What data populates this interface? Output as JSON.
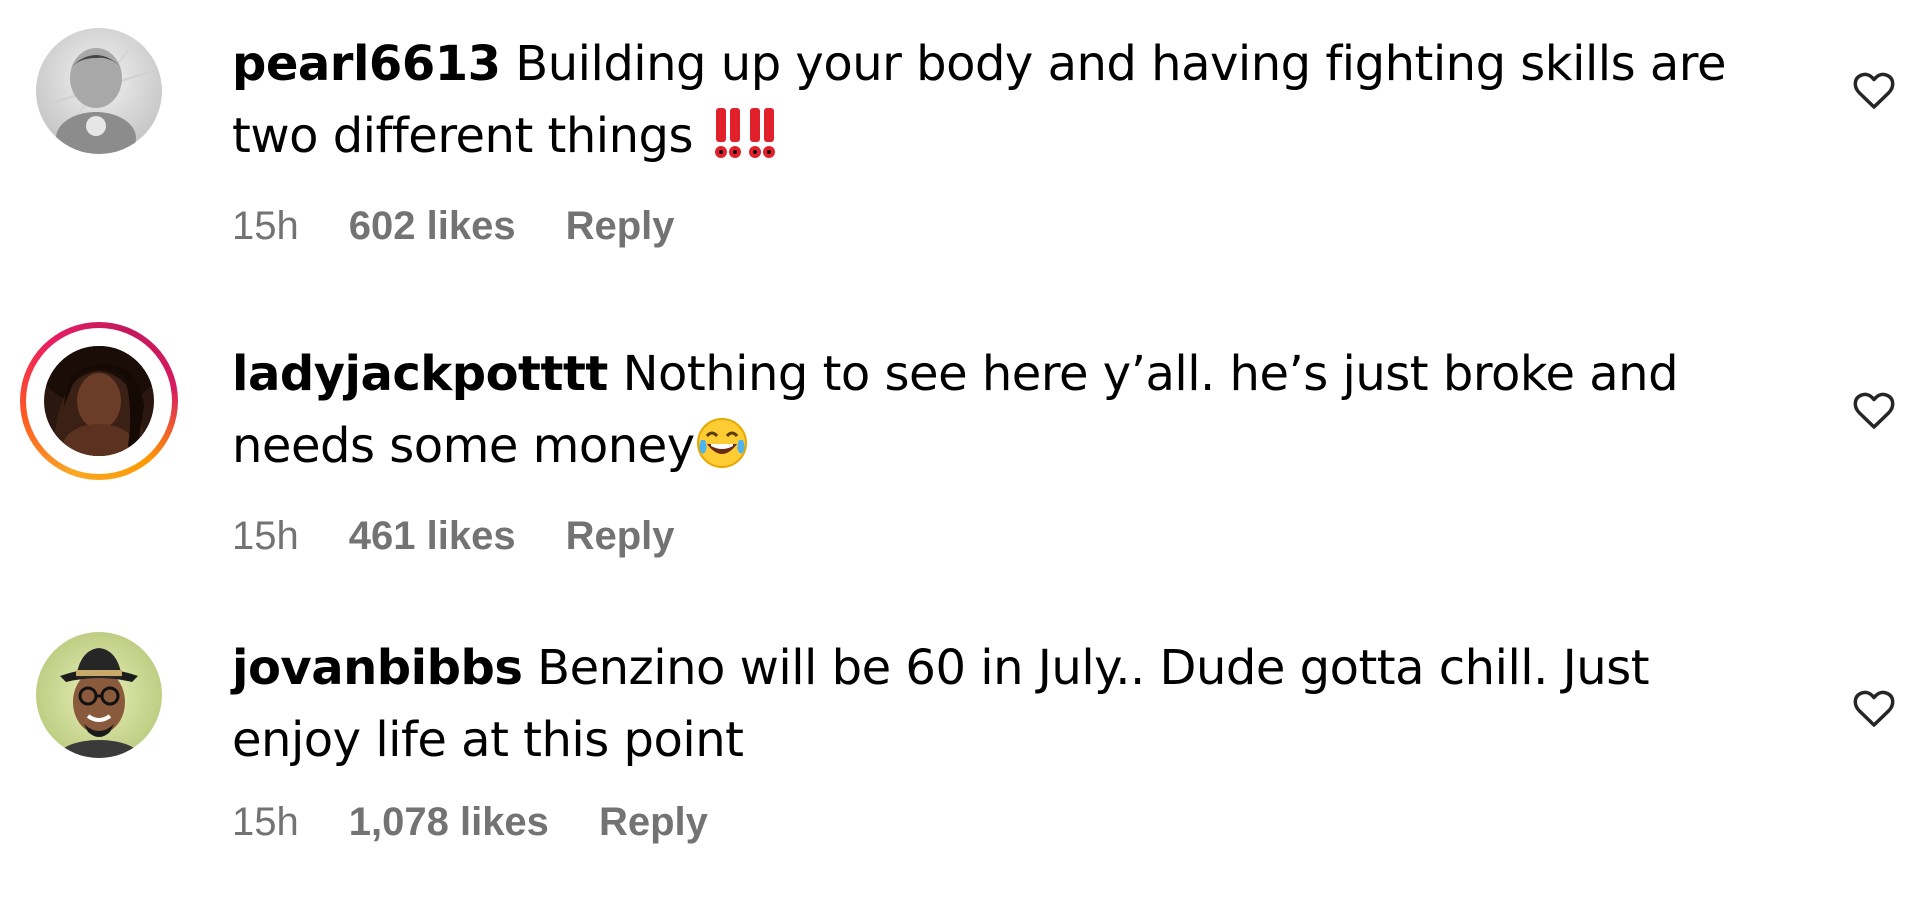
{
  "comments": [
    {
      "username": "pearl6613",
      "text": "Building up your body and having fighting skills are two different things",
      "emoji": "‼️‼️",
      "time": "15h",
      "likes": "602 likes",
      "reply_label": "Reply",
      "avatar_icon": "user-avatar-grayscale",
      "has_story": false
    },
    {
      "username": "ladyjackpotttt",
      "text": "Nothing to see here y’all. he’s just broke and needs some money",
      "emoji": "😂",
      "time": "15h",
      "likes": "461 likes",
      "reply_label": "Reply",
      "avatar_icon": "user-avatar-with-story-ring",
      "has_story": true
    },
    {
      "username": "jovanbibbs",
      "text": "Benzino will be 60 in July.. Dude gotta chill. Just enjoy life at this point",
      "emoji": "",
      "time": "15h",
      "likes": "1,078 likes",
      "reply_label": "Reply",
      "avatar_icon": "user-avatar-hat",
      "has_story": false
    }
  ],
  "icons": {
    "like": "heart-icon"
  },
  "colors": {
    "meta_text": "#737373",
    "text": "#000000",
    "background": "#ffffff",
    "exclamation": "#e0202b"
  }
}
